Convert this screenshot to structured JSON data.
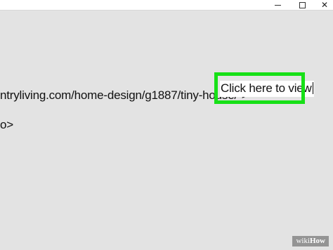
{
  "window": {
    "controls": {
      "minimize_icon": "minimize-icon",
      "maximize_icon": "maximize-icon",
      "close_icon": "close-icon",
      "close_glyph": "✕"
    }
  },
  "editor": {
    "line_1": "ntryliving.com/home-design/g1887/tiny-house/\">",
    "line_2": "o>",
    "typed_text": "Click here to view"
  },
  "highlight": {
    "color": "#17e017"
  },
  "watermark": {
    "wiki": "wiki",
    "how": "How"
  }
}
